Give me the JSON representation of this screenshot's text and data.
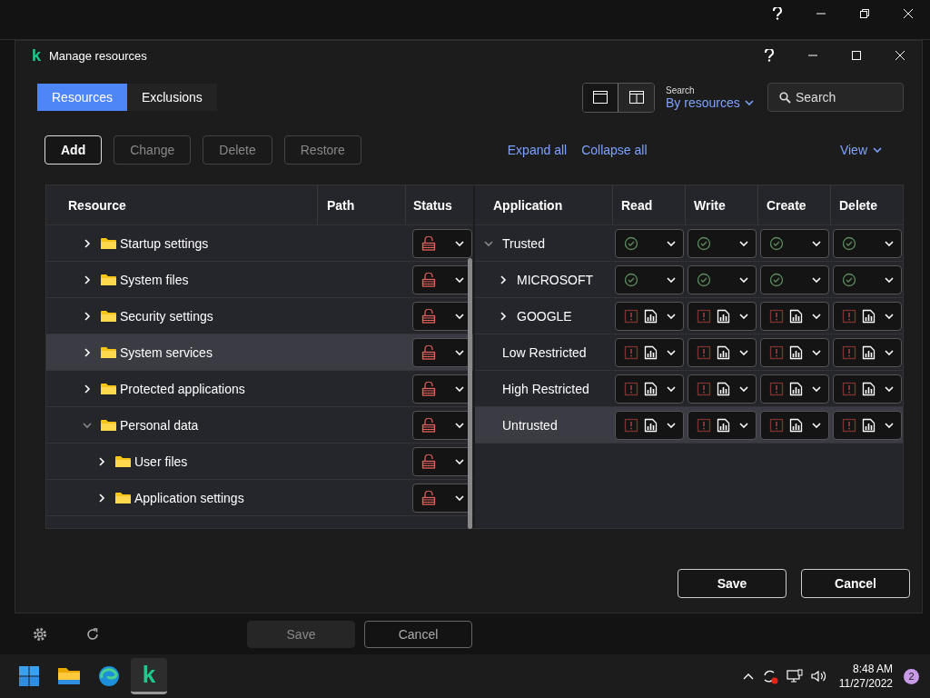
{
  "background_window": {
    "controls": [
      {
        "kind": "help"
      },
      {
        "kind": "minimize"
      },
      {
        "kind": "restore"
      },
      {
        "kind": "close"
      }
    ],
    "footer_buttons": [
      {
        "label": "Save",
        "disabled": true
      },
      {
        "label": "Cancel",
        "disabled": false
      }
    ]
  },
  "dialog": {
    "logo": "k",
    "title": "Manage resources",
    "controls": [
      {
        "kind": "help"
      },
      {
        "kind": "minimize"
      },
      {
        "kind": "maximize"
      },
      {
        "kind": "close"
      }
    ],
    "tabs": [
      {
        "label": "Resources",
        "selected": true
      },
      {
        "label": "Exclusions",
        "selected": false
      }
    ],
    "layout_toggle": [
      {
        "kind": "single",
        "selected": true
      },
      {
        "kind": "split",
        "selected": false
      }
    ],
    "search_mode": {
      "label": "Search",
      "value": "By resources"
    },
    "search": {
      "placeholder": "Search"
    },
    "toolbar": [
      {
        "label": "Add",
        "disabled": false
      },
      {
        "label": "Change",
        "disabled": true
      },
      {
        "label": "Delete",
        "disabled": true
      },
      {
        "label": "Restore",
        "disabled": true
      }
    ],
    "links": [
      "Expand all",
      "Collapse all"
    ],
    "view_menu": "View",
    "resource_table": {
      "columns": [
        "Resource",
        "Path",
        "Status"
      ],
      "rows": [
        {
          "children": [
            {
              "label": "Startup settings",
              "expanded": false,
              "selected": false,
              "locked": false
            },
            {
              "label": "System files",
              "expanded": false,
              "selected": false,
              "locked": false
            },
            {
              "label": "Security settings",
              "expanded": false,
              "selected": false,
              "locked": false
            },
            {
              "label": "System services",
              "expanded": false,
              "selected": true,
              "locked": false
            },
            {
              "label": "Protected applications",
              "expanded": false,
              "selected": false,
              "locked": false
            }
          ]
        },
        {
          "label": "Personal data",
          "expanded": true,
          "selected": false,
          "locked": false,
          "children": [
            {
              "label": "User files",
              "expanded": false,
              "selected": false,
              "locked": false
            },
            {
              "label": "Application settings",
              "expanded": false,
              "selected": false,
              "locked": false
            }
          ]
        }
      ]
    },
    "application_table": {
      "columns": [
        "Application",
        "Read",
        "Write",
        "Create",
        "Delete"
      ],
      "rows": [
        {
          "label": "Trusted",
          "expanded": true,
          "selected": false,
          "rights": [
            {
              "kind": "allow"
            },
            {
              "kind": "allow"
            },
            {
              "kind": "allow"
            },
            {
              "kind": "allow"
            }
          ],
          "children": [
            {
              "label": "MICROSOFT",
              "expanded": false,
              "selected": false,
              "rights": [
                {
                  "kind": "allow"
                },
                {
                  "kind": "allow"
                },
                {
                  "kind": "allow"
                },
                {
                  "kind": "allow"
                }
              ]
            },
            {
              "label": "GOOGLE",
              "expanded": false,
              "selected": false,
              "rights": [
                {
                  "kind": "ask_log"
                },
                {
                  "kind": "ask_log"
                },
                {
                  "kind": "ask_log"
                },
                {
                  "kind": "ask_log"
                }
              ]
            }
          ]
        },
        {
          "label": "Low Restricted",
          "selected": false,
          "rights": [
            {
              "kind": "ask_log"
            },
            {
              "kind": "ask_log"
            },
            {
              "kind": "ask_log"
            },
            {
              "kind": "ask_log"
            }
          ]
        },
        {
          "label": "High Restricted",
          "selected": false,
          "rights": [
            {
              "kind": "ask_log"
            },
            {
              "kind": "ask_log"
            },
            {
              "kind": "ask_log"
            },
            {
              "kind": "ask_log"
            }
          ]
        },
        {
          "label": "Untrusted",
          "selected": true,
          "rights": [
            {
              "kind": "ask_log"
            },
            {
              "kind": "ask_log"
            },
            {
              "kind": "ask_log"
            },
            {
              "kind": "ask_log"
            }
          ]
        }
      ]
    },
    "buttons": [
      "Save",
      "Cancel"
    ]
  },
  "taskbar": {
    "apps": [
      {
        "kind": "start",
        "selected": false
      },
      {
        "kind": "files",
        "selected": false
      },
      {
        "kind": "browser",
        "selected": false
      },
      {
        "kind": "logo",
        "label": "k",
        "selected": true
      }
    ],
    "time": "8:48 AM",
    "date": "11/27/2022",
    "notifications": "2"
  }
}
